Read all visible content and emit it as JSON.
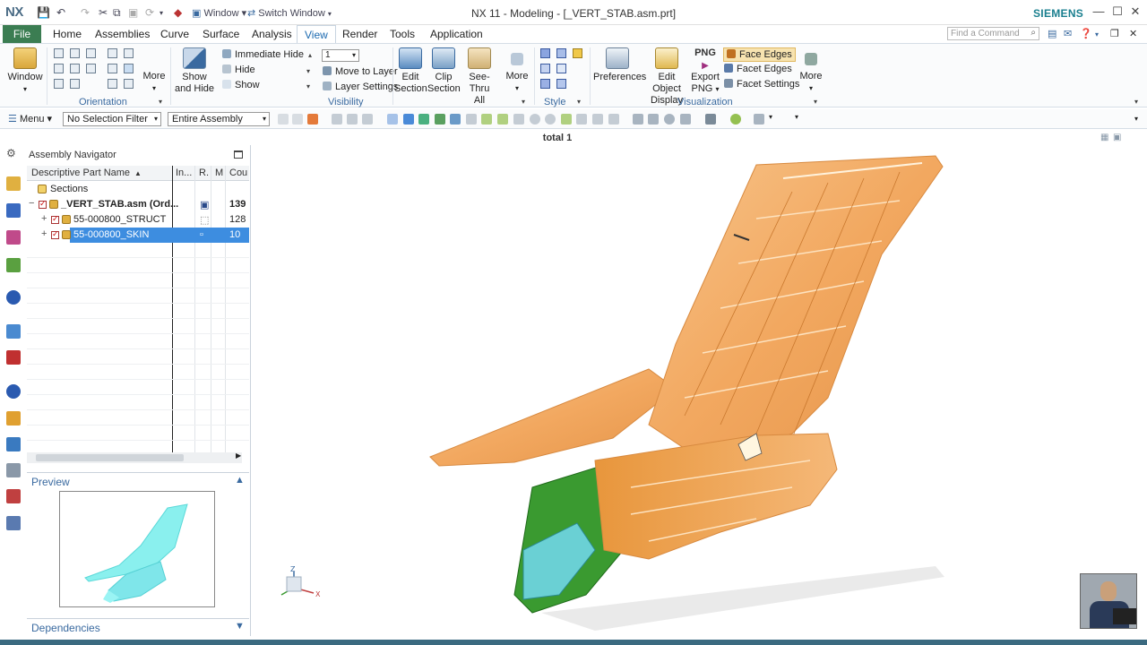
{
  "titlebar": {
    "logo": "NX",
    "window_menu": "Window ▾",
    "switch_window": "Switch Window",
    "title": "NX 11 - Modeling - [_VERT_STAB.asm.prt]",
    "brand": "SIEMENS"
  },
  "tabs": [
    "File",
    "Home",
    "Assemblies",
    "Curve",
    "Surface",
    "Analysis",
    "View",
    "Render",
    "Tools",
    "Application"
  ],
  "active_tab": "View",
  "search": {
    "placeholder": "Find a Command"
  },
  "ribbon": {
    "window_btn": "Window",
    "orientation_more": "More",
    "orientation_label": "Orientation",
    "show_hide_1": "Show",
    "show_hide_2": "and Hide",
    "immediate_hide": "Immediate Hide",
    "hide": "Hide",
    "show": "Show",
    "layer_value": "1",
    "move_to_layer": "Move to Layer",
    "layer_settings": "Layer Settings",
    "visibility_label": "Visibility",
    "edit_section_1": "Edit",
    "edit_section_2": "Section",
    "clip_section_1": "Clip",
    "clip_section_2": "Section",
    "see_thru_1": "See-Thru",
    "see_thru_2": "All",
    "vis_more": "More",
    "style_label": "Style",
    "preferences": "Preferences",
    "edit_obj_1": "Edit Object",
    "edit_obj_2": "Display",
    "png_badge": "PNG",
    "export_1": "Export",
    "export_2": "PNG",
    "face_edges": "Face Edges",
    "facet_edges": "Facet Edges",
    "facet_settings": "Facet Settings",
    "viz_more": "More",
    "visualization_label": "Visualization"
  },
  "toolbar2": {
    "menu": "Menu ▾",
    "selection_filter": "No Selection Filter",
    "assembly_scope": "Entire Assembly"
  },
  "graphics": {
    "view_title": "total 1"
  },
  "navigator": {
    "title": "Assembly Navigator",
    "columns": [
      "Descriptive Part Name",
      "In...",
      "R.",
      "M",
      "Cou"
    ],
    "rows": [
      {
        "name": "Sections",
        "count": ""
      },
      {
        "name": "_VERT_STAB.asm (Ord...",
        "count": "139"
      },
      {
        "name": "55-000800_STRUCT",
        "count": "128"
      },
      {
        "name": "55-000800_SKIN",
        "count": "10"
      }
    ],
    "preview_title": "Preview",
    "dependencies_title": "Dependencies"
  },
  "colors": {
    "file_tab": "#3b7d52",
    "accent": "#1c6ab0",
    "selection": "#3d8de0",
    "skin_orange": "#f2a860",
    "struct_green": "#3a9a30",
    "preview_cyan": "#7fe6ea"
  },
  "triad_axes": [
    "Z",
    "X"
  ]
}
